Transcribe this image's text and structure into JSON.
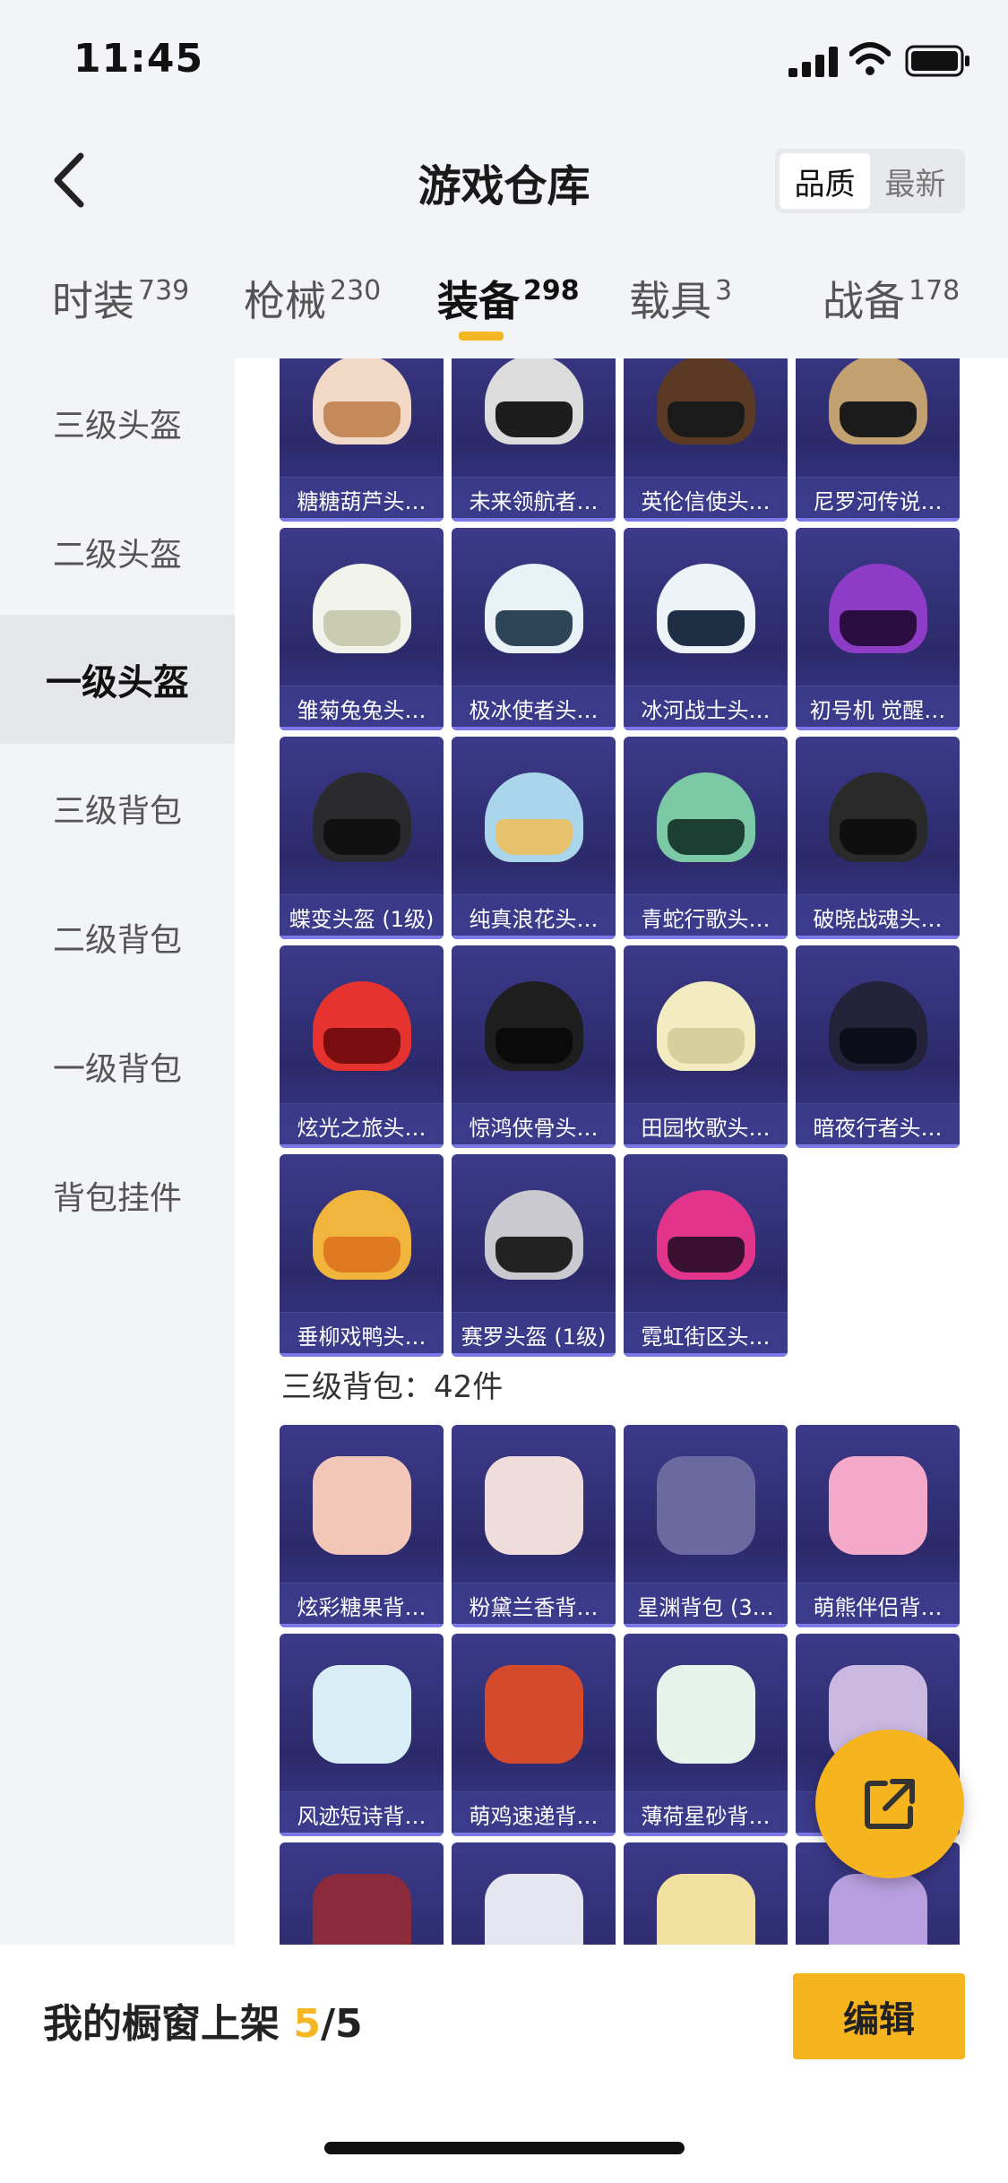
{
  "status": {
    "time": "11:45"
  },
  "header": {
    "title": "游戏仓库",
    "sort_options": [
      "品质",
      "最新"
    ],
    "sort_active": "品质"
  },
  "tabs": [
    {
      "label": "时装",
      "count": "739"
    },
    {
      "label": "枪械",
      "count": "230"
    },
    {
      "label": "装备",
      "count": "298"
    },
    {
      "label": "载具",
      "count": "3"
    },
    {
      "label": "战备",
      "count": "178"
    }
  ],
  "active_tab": "装备",
  "sidebar": [
    {
      "label": "三级头盔"
    },
    {
      "label": "二级头盔"
    },
    {
      "label": "一级头盔"
    },
    {
      "label": "三级背包"
    },
    {
      "label": "二级背包"
    },
    {
      "label": "一级背包"
    },
    {
      "label": "背包挂件"
    }
  ],
  "sidebar_active": "一级头盔",
  "helmets": [
    {
      "name": "糖糖葫芦头…",
      "color": "#f2d8c6",
      "visor": "#c48a5a"
    },
    {
      "name": "未来领航者…",
      "color": "#dcdcdc",
      "visor": "#1d1d1d"
    },
    {
      "name": "英伦信使头…",
      "color": "#5a3a24",
      "visor": "#1a1a1a"
    },
    {
      "name": "尼罗河传说…",
      "color": "#c2a070",
      "visor": "#1b1b1b"
    },
    {
      "name": "雏菊兔兔头…",
      "color": "#f1f3ea",
      "visor": "#c9ccb0"
    },
    {
      "name": "极冰使者头…",
      "color": "#e8f1f6",
      "visor": "#2e4457"
    },
    {
      "name": "冰河战士头…",
      "color": "#eef3f8",
      "visor": "#1e2f45"
    },
    {
      "name": "初号机 觉醒…",
      "color": "#8e3cc8",
      "visor": "#2c0d3f"
    },
    {
      "name": "蝶变头盔 (1级)",
      "color": "#2b2b2f",
      "visor": "#111"
    },
    {
      "name": "纯真浪花头…",
      "color": "#a9d6ea",
      "visor": "#e8c16c"
    },
    {
      "name": "青蛇行歌头…",
      "color": "#7cc9a5",
      "visor": "#1d3e32"
    },
    {
      "name": "破晓战魂头…",
      "color": "#2a2a2a",
      "visor": "#0f0f0f"
    },
    {
      "name": "炫光之旅头…",
      "color": "#e6332f",
      "visor": "#7a0d10"
    },
    {
      "name": "惊鸿侠骨头…",
      "color": "#1e1e1e",
      "visor": "#0b0b0b"
    },
    {
      "name": "田园牧歌头…",
      "color": "#f2ecc0",
      "visor": "#d7cf9d"
    },
    {
      "name": "暗夜行者头…",
      "color": "#23223a",
      "visor": "#0d0d1a"
    },
    {
      "name": "垂柳戏鸭头…",
      "color": "#f1b43c",
      "visor": "#e07a22"
    },
    {
      "name": "赛罗头盔 (1级)",
      "color": "#c9c9cf",
      "visor": "#222"
    },
    {
      "name": "霓虹街区头…",
      "color": "#e3348c",
      "visor": "#3a1030"
    }
  ],
  "section": {
    "title": "三级背包：42件"
  },
  "bags": [
    {
      "name": "炫彩糖果背…",
      "color": "#f2c7b8"
    },
    {
      "name": "粉黛兰香背…",
      "color": "#f1dcdc"
    },
    {
      "name": "星渊背包 (3…",
      "color": "#6a6aa0"
    },
    {
      "name": "萌熊伴侣背…",
      "color": "#f3a9c7"
    },
    {
      "name": "风迹短诗背…",
      "color": "#d8eef7"
    },
    {
      "name": "萌鸡速递背…",
      "color": "#d64a2c"
    },
    {
      "name": "薄荷星砂背…",
      "color": "#e6f2ea"
    },
    {
      "name": "",
      "color": "#c9b8e0"
    },
    {
      "name": "",
      "color": "#8a2a3a"
    },
    {
      "name": "",
      "color": "#e6e6f0"
    },
    {
      "name": "",
      "color": "#f2e0a0"
    },
    {
      "name": "",
      "color": "#b8a0e0"
    }
  ],
  "bottom": {
    "caption_prefix": "我的橱窗上架 ",
    "current": "5",
    "sep_total": "/5",
    "edit_label": "编辑"
  }
}
